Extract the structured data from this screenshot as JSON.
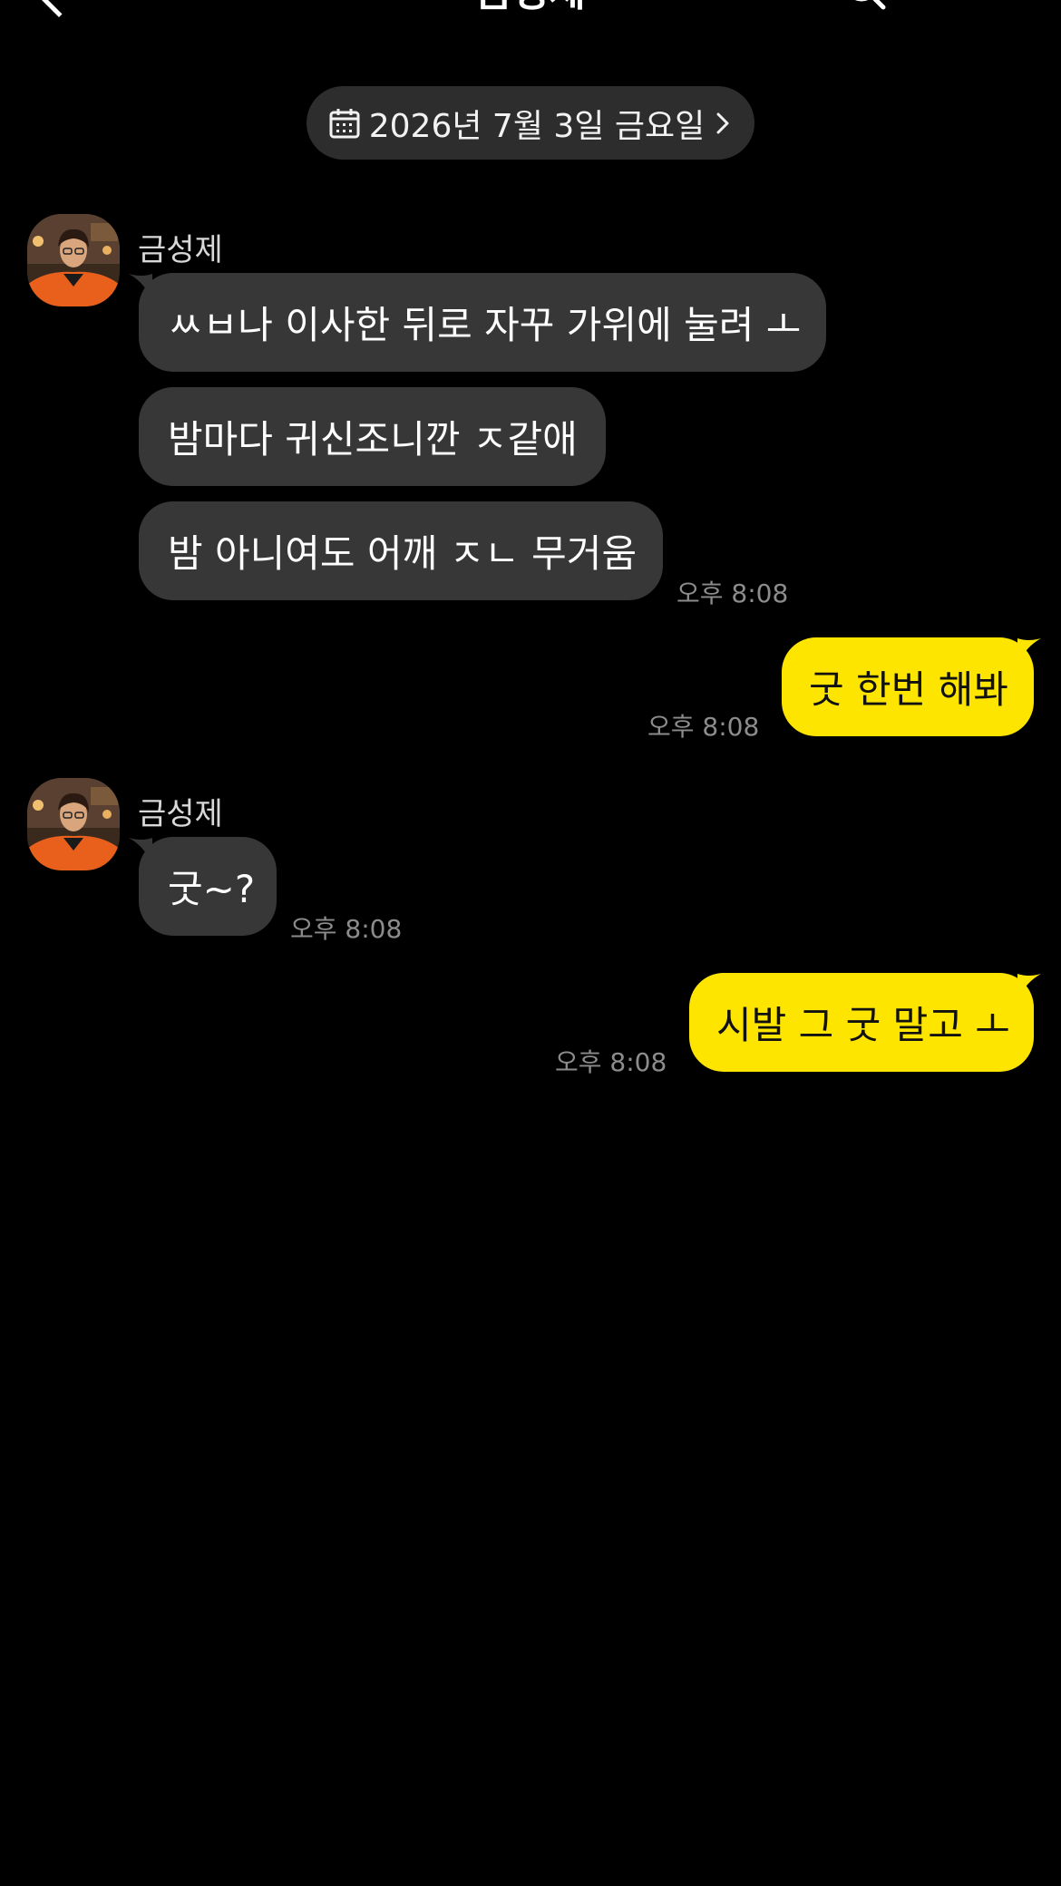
{
  "header": {
    "title": "금성제",
    "back_icon": "chevron-left-icon",
    "search_icon": "search-icon"
  },
  "date_divider": {
    "label": "2026년 7월 3일 금요일",
    "icon": "calendar-icon",
    "chevron": "chevron-right-icon"
  },
  "colors": {
    "background": "#000000",
    "incoming_bubble": "#373737",
    "outgoing_bubble": "#fde500",
    "timestamp": "#8c8c8c"
  },
  "messages": [
    {
      "sender": "금성제",
      "direction": "incoming",
      "texts": [
        "ㅆㅂ나 이사한 뒤로 자꾸 가위에 눌려 ㅗ",
        "밤마다 귀신조니깐 ㅈ같애",
        "밤 아니여도 어깨 ㅈㄴ 무거움"
      ],
      "time": "오후 8:08"
    },
    {
      "direction": "outgoing",
      "texts": [
        "굿 한번 해봐"
      ],
      "time": "오후 8:08"
    },
    {
      "sender": "금성제",
      "direction": "incoming",
      "texts": [
        "굿~?"
      ],
      "time": "오후 8:08"
    },
    {
      "direction": "outgoing",
      "texts": [
        "시발 그 굿 말고 ㅗ"
      ],
      "time": "오후 8:08"
    }
  ]
}
